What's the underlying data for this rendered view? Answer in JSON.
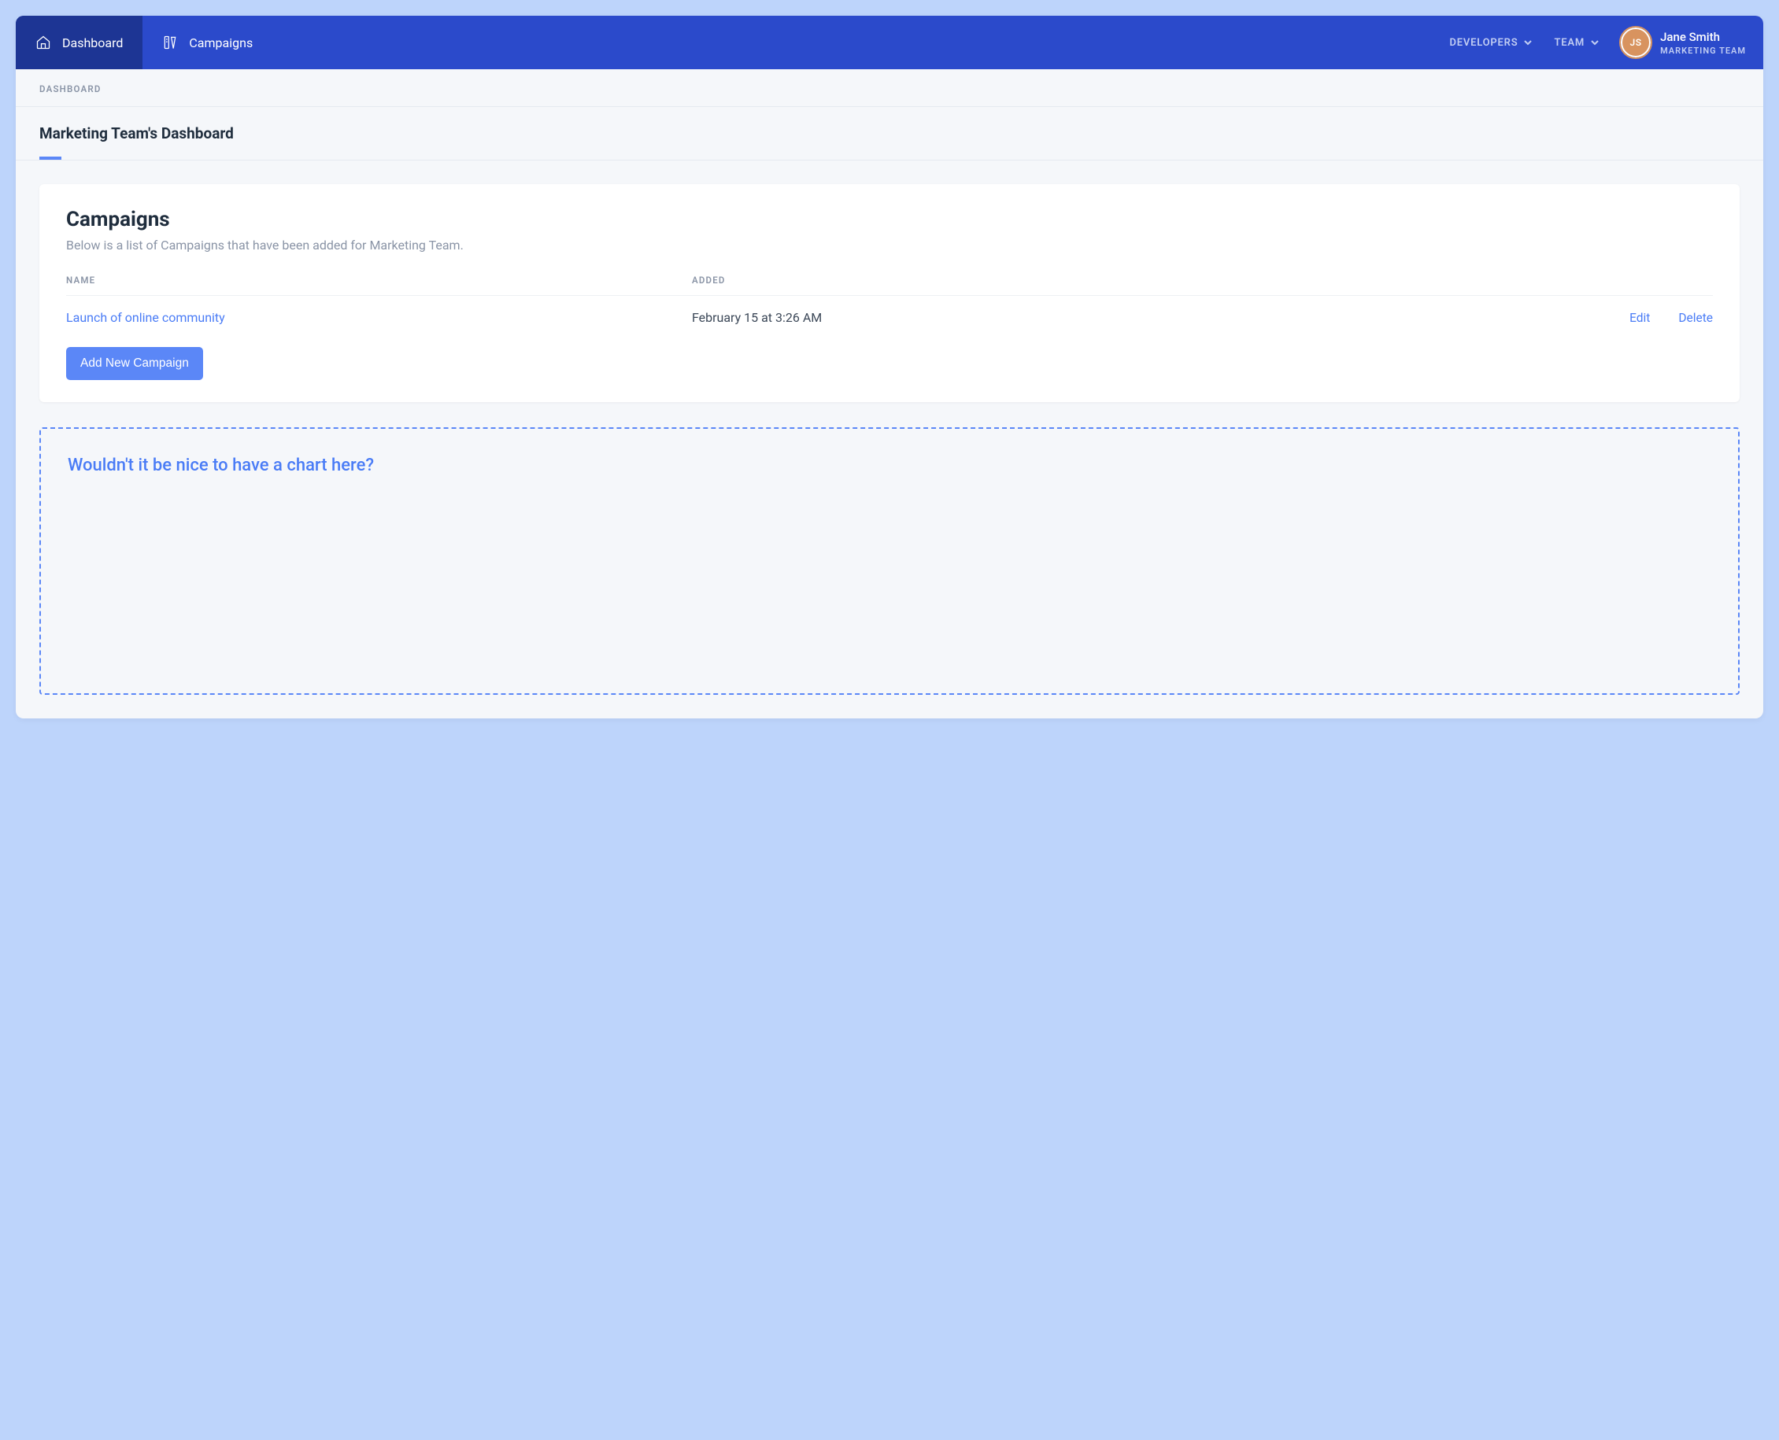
{
  "nav": {
    "items": [
      {
        "label": "Dashboard",
        "icon": "home-icon",
        "active": true
      },
      {
        "label": "Campaigns",
        "icon": "design-icon",
        "active": false
      }
    ],
    "dropdowns": [
      {
        "label": "DEVELOPERS"
      },
      {
        "label": "TEAM"
      }
    ],
    "user": {
      "name": "Jane Smith",
      "subtitle": "MARKETING TEAM",
      "initials": "JS"
    }
  },
  "breadcrumb": "DASHBOARD",
  "page_title": "Marketing Team's Dashboard",
  "campaigns_card": {
    "title": "Campaigns",
    "subtitle": "Below is a list of Campaigns that have been added for Marketing Team.",
    "columns": {
      "name": "NAME",
      "added": "ADDED"
    },
    "rows": [
      {
        "name": "Launch of online community",
        "added": "February 15 at 3:26 AM"
      }
    ],
    "actions": {
      "edit": "Edit",
      "delete": "Delete"
    },
    "add_button": "Add New Campaign"
  },
  "placeholder": {
    "text": "Wouldn't it be nice to have a chart here?"
  }
}
